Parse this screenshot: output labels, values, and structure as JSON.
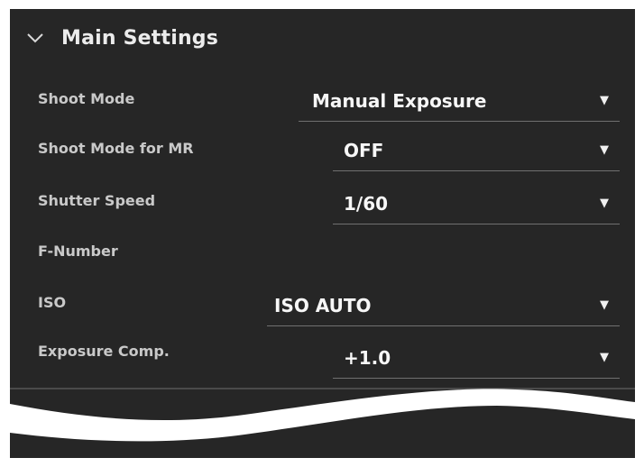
{
  "section": {
    "title": "Main Settings",
    "expanded": true,
    "icon": "chevron-down-icon"
  },
  "settings": [
    {
      "label": "Shoot Mode",
      "value": "Manual Exposure"
    },
    {
      "label": "Shoot Mode for MR",
      "value": "OFF"
    },
    {
      "label": "Shutter Speed",
      "value": "1/60"
    },
    {
      "label": "F-Number",
      "value": null
    },
    {
      "label": "ISO",
      "value": "ISO AUTO"
    },
    {
      "label": "Exposure Comp.",
      "value": "+1.0"
    }
  ],
  "caret_icon": "triangle-down-icon",
  "colors": {
    "panel_background": "#262626",
    "text_primary": "#f7f7f7",
    "text_label": "#c9c9c9",
    "underline": "#707070"
  }
}
